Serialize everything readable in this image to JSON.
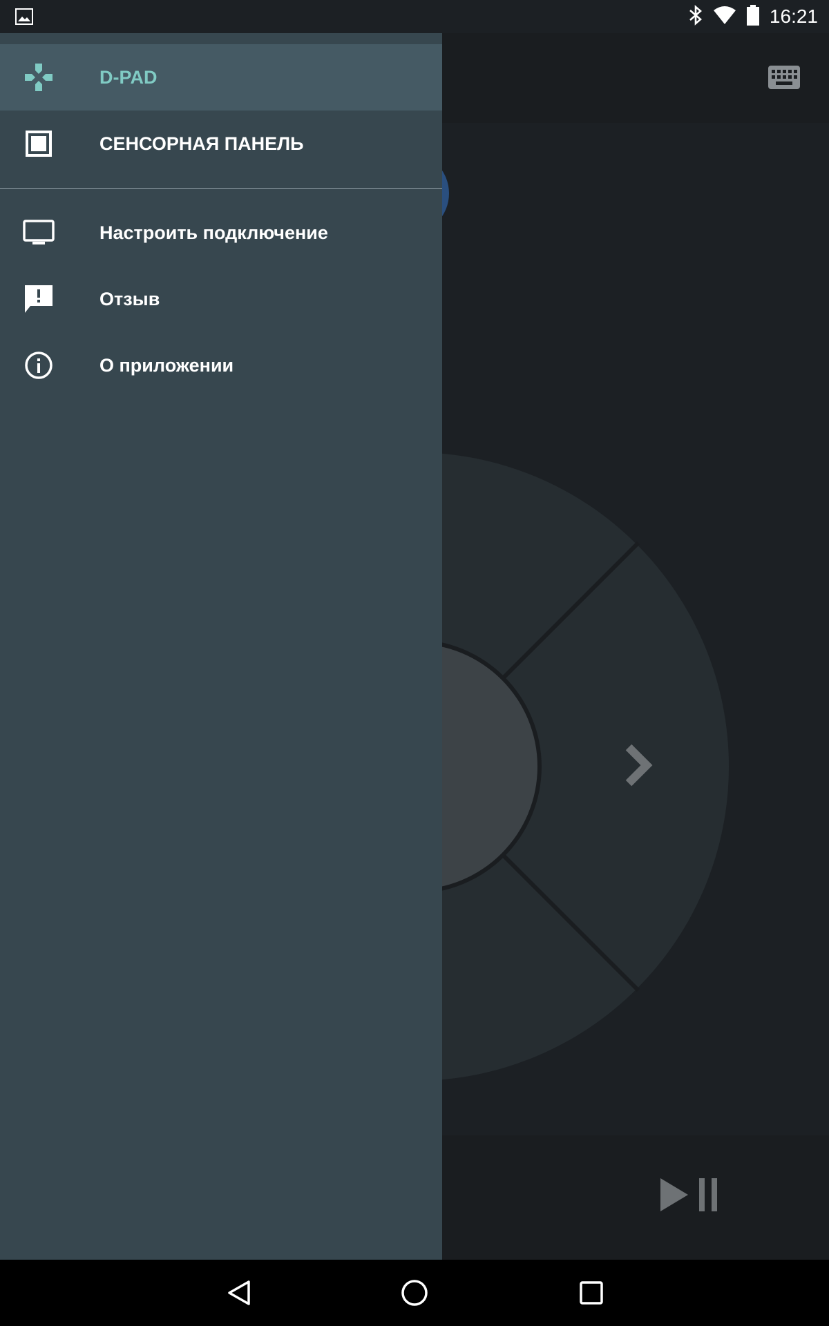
{
  "status_bar": {
    "time": "16:21",
    "icons": [
      "image-notification-icon",
      "bluetooth-icon",
      "wifi-icon",
      "battery-icon"
    ]
  },
  "drawer": {
    "primary_items": [
      {
        "label": "D-PAD",
        "icon": "gamepad-icon",
        "selected": true
      },
      {
        "label": "СЕНСОРНАЯ ПАНЕЛЬ",
        "icon": "touchpad-icon",
        "selected": false
      }
    ],
    "secondary_items": [
      {
        "label": "Настроить подключение",
        "icon": "tv-icon"
      },
      {
        "label": "Отзыв",
        "icon": "feedback-icon"
      },
      {
        "label": "О приложении",
        "icon": "info-icon"
      }
    ]
  },
  "background_app": {
    "icons": [
      "keyboard-icon",
      "chevron-right-icon",
      "play-pause-icon"
    ]
  },
  "nav_bar": {
    "icons": [
      "back-icon",
      "home-icon",
      "recents-icon"
    ]
  },
  "colors": {
    "drawer_bg": "#37474f",
    "selected_bg": "#455a64",
    "accent": "#80cbc4",
    "app_bg": "#1c2024"
  }
}
